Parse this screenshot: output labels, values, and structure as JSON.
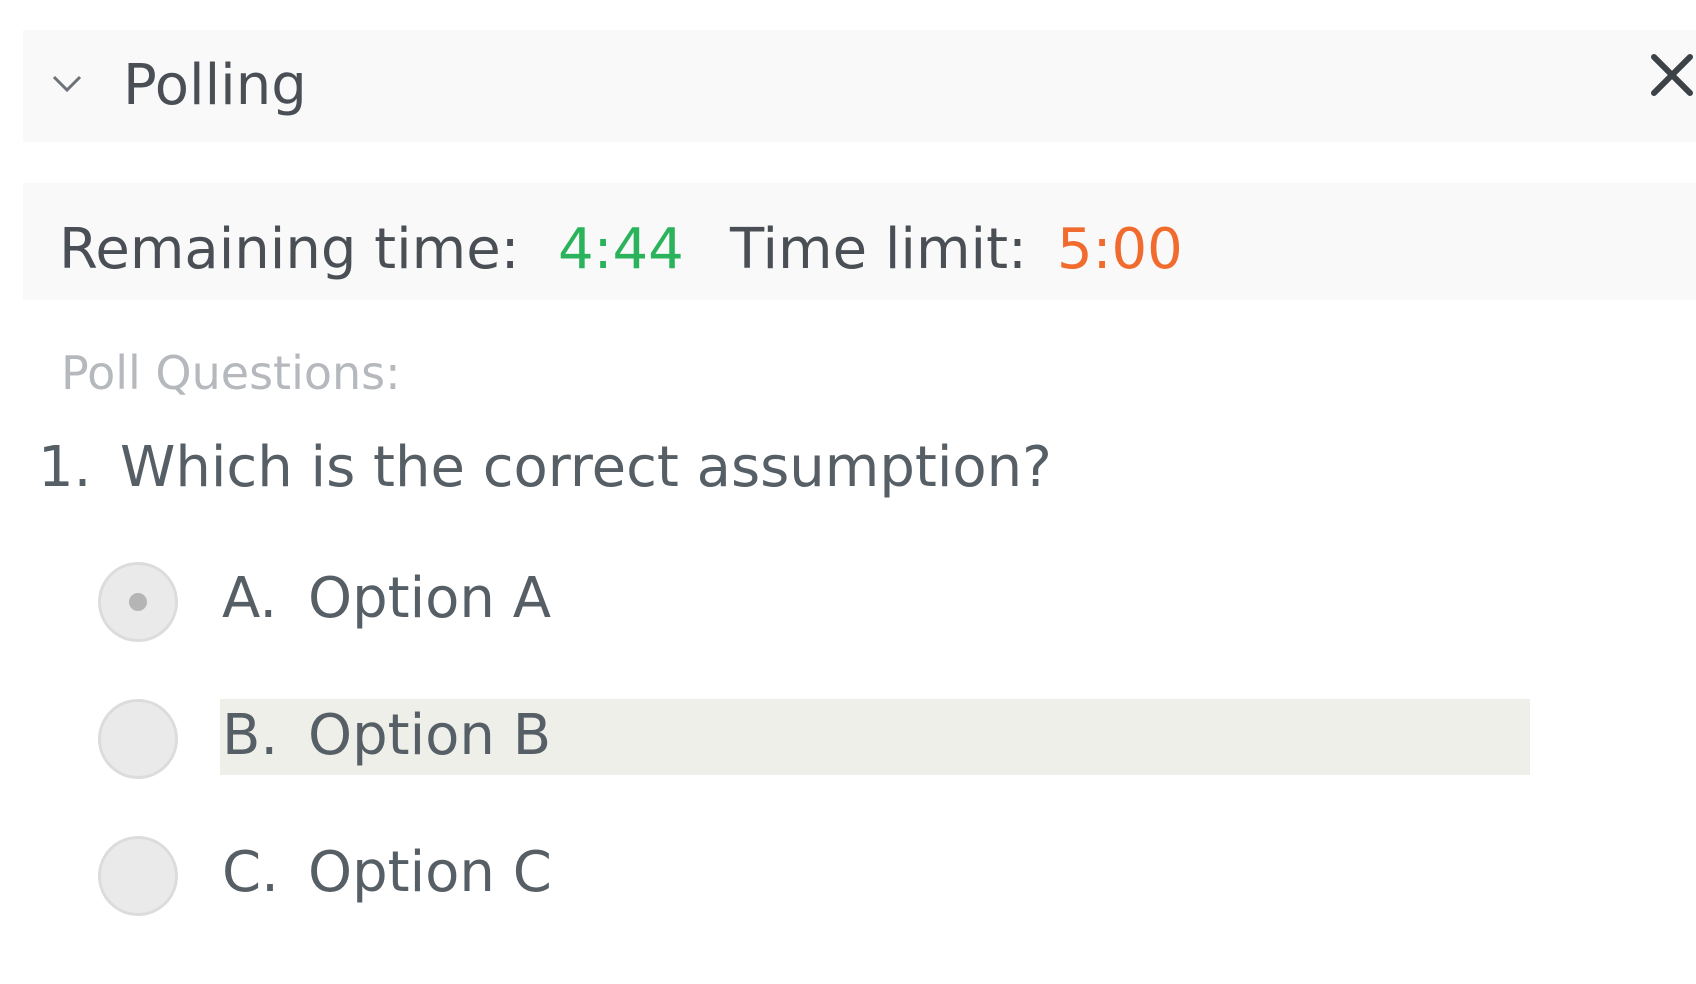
{
  "header": {
    "title": "Polling",
    "collapse_icon": "chevron-down-icon",
    "close_icon": "close-icon"
  },
  "timer": {
    "remaining_label": "Remaining time:",
    "remaining_value": "4:44",
    "remaining_color": "#2bb35c",
    "limit_label": "Time limit:",
    "limit_value": "5:00",
    "limit_color": "#f26b2e"
  },
  "questions": {
    "heading": "Poll Questions:",
    "items": [
      {
        "number": "1.",
        "text": "Which is the correct assumption?",
        "options": [
          {
            "letter": "A.",
            "label": "Option A",
            "selected": true
          },
          {
            "letter": "B.",
            "label": "Option B",
            "selected": false,
            "hovered": true
          },
          {
            "letter": "C.",
            "label": "Option C",
            "selected": false
          }
        ]
      }
    ]
  }
}
